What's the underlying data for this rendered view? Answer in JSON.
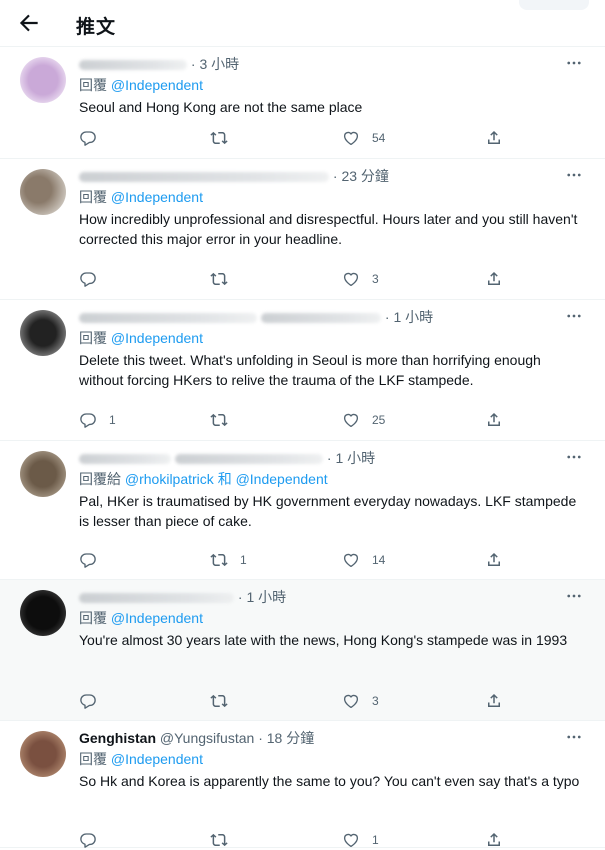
{
  "header": {
    "title": "推文"
  },
  "tweets": [
    {
      "meta": "· 3 小時",
      "reply_prefix": "回覆",
      "reply_to": "@Independent",
      "text": "Seoul and Hong Kong are not the same place",
      "counts": {
        "reply": "",
        "retweet": "",
        "like": "54"
      }
    },
    {
      "meta": "· 23 分鐘",
      "reply_prefix": "回覆",
      "reply_to": "@Independent",
      "text": "How incredibly unprofessional and disrespectful. Hours later and you still haven't corrected this major error in your headline.",
      "counts": {
        "reply": "",
        "retweet": "",
        "like": "3"
      }
    },
    {
      "meta": "· 1 小時",
      "reply_prefix": "回覆",
      "reply_to": "@Independent",
      "text": "Delete this tweet. What's unfolding in Seoul is more than horrifying enough without forcing HKers to relive the trauma of the LKF stampede.",
      "counts": {
        "reply": "1",
        "retweet": "",
        "like": "25"
      }
    },
    {
      "meta": "· 1 小時",
      "reply_prefix": "回覆給",
      "reply_to": "@rhokilpatrick",
      "reply_and": "和",
      "reply_to2": "@Independent",
      "text": "Pal, HKer is traumatised by HK government everyday nowadays. LKF stampede is lesser than piece of cake.",
      "counts": {
        "reply": "",
        "retweet": "1",
        "like": "14"
      }
    },
    {
      "meta": "· 1 小時",
      "reply_prefix": "回覆",
      "reply_to": "@Independent",
      "text": "You're almost 30 years late with the news, Hong Kong's stampede was in 1993",
      "counts": {
        "reply": "",
        "retweet": "",
        "like": "3"
      }
    },
    {
      "name": "Genghistan",
      "handle": "@Yungsifustan",
      "meta": "· 18 分鐘",
      "reply_prefix": "回覆",
      "reply_to": "@Independent",
      "text": "So Hk and Korea is apparently the same to you? You can't even say that's a typo",
      "counts": {
        "reply": "",
        "retweet": "",
        "like": "1"
      }
    }
  ],
  "icons": {
    "back": "arrow-left-icon",
    "more": "more-horizontal-icon",
    "reply": "reply-bubble-icon",
    "retweet": "retweet-icon",
    "like": "heart-icon",
    "share": "share-upload-icon"
  },
  "colors": {
    "link": "#1d9bf0",
    "muted": "#536471",
    "text": "#0f1419",
    "highlight_bg": "#f7f9f9"
  }
}
